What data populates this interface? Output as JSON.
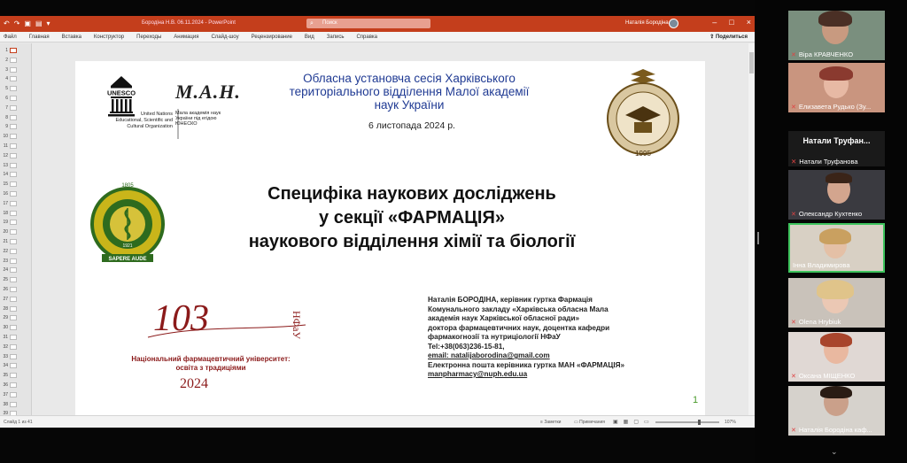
{
  "ppt": {
    "window_title": "Бородіна Н.В. 06.11.2024 - PowerPoint",
    "search_placeholder": "Поиск",
    "user_name": "Наталія Бородіна",
    "ribbon_tabs": [
      "Файл",
      "Главная",
      "Вставка",
      "Конструктор",
      "Переходы",
      "Анимация",
      "Слайд-шоу",
      "Рецензирование",
      "Вид",
      "Запись",
      "Справка"
    ],
    "share_label": "Поделиться",
    "status_slide": "Слайд 1 из 41",
    "notes_label": "Заметки",
    "comments_label": "Примечания",
    "zoom_level": "107%",
    "thumb_numbers": [
      "1",
      "2",
      "3",
      "4",
      "5",
      "6",
      "7",
      "8",
      "9",
      "10",
      "11",
      "12",
      "13",
      "14",
      "15",
      "16",
      "17",
      "18",
      "19",
      "20",
      "21",
      "22",
      "23",
      "24",
      "25",
      "26",
      "27",
      "28",
      "29",
      "30",
      "31",
      "32",
      "33",
      "34",
      "35",
      "36",
      "37",
      "38",
      "39"
    ]
  },
  "slide": {
    "unesco_label": "UNESCO",
    "unesco_name": "United Nations\nEducational, Scientific and\nCultural Organization",
    "man_logo": "M.A.H.",
    "man_sub": "Мала академія наук\nУкраїни під егідою\nЮНЕСКО",
    "session_title": "Обласна установча сесія Харківського територіального відділення Малої академії наук України",
    "session_date": "6 листопада 2024 р.",
    "seal_right_year": "1995",
    "seal_left_year_top": "1805",
    "seal_left_year_mid": "1921",
    "seal_left_motto": "SAPERE AUDE",
    "main_title_1": "Специфіка наукових досліджень",
    "main_title_2": "у секції «ФАРМАЦІЯ»",
    "main_title_3": "наукового  відділення хімії та біології",
    "nfau_number": "103",
    "nfau_letters": "НФаУ",
    "univ_name": "Національний фармацевтичний університет:\nосвіта з традиціями",
    "univ_year": "2024",
    "info_lines": [
      "Наталія БОРОДІНА, керівник гуртка Фармація",
      "Комунального закладу «Харківська обласна Мала",
      "академія наук Харківської обласної ради»",
      "доктора фармацевтичних наук, доцентка кафедри",
      "фармакогнозії та нутриціології НФаУ",
      "Tel:+38(063)236-15-81,",
      "email: natalijaborodina@gmail.com",
      "Електронна пошта керівника гуртка МАН «ФАРМАЦІЯ»",
      "manpharmacy@nuph.edu.ua"
    ],
    "slide_number": "1"
  },
  "participants": [
    {
      "name": "Віра КРАВЧЕНКО"
    },
    {
      "name": "Елизавета Рудько (Зу..."
    },
    {
      "name": "Натали Труфанова",
      "display": "Натали  Труфан..."
    },
    {
      "name": "Олександр Кухтенко"
    },
    {
      "name": "Інна Владимирова"
    },
    {
      "name": "Olena Hrybiuk"
    },
    {
      "name": "Оксана МІЩЕНКО"
    },
    {
      "name": "Наталія Бородіна каф..."
    }
  ]
}
